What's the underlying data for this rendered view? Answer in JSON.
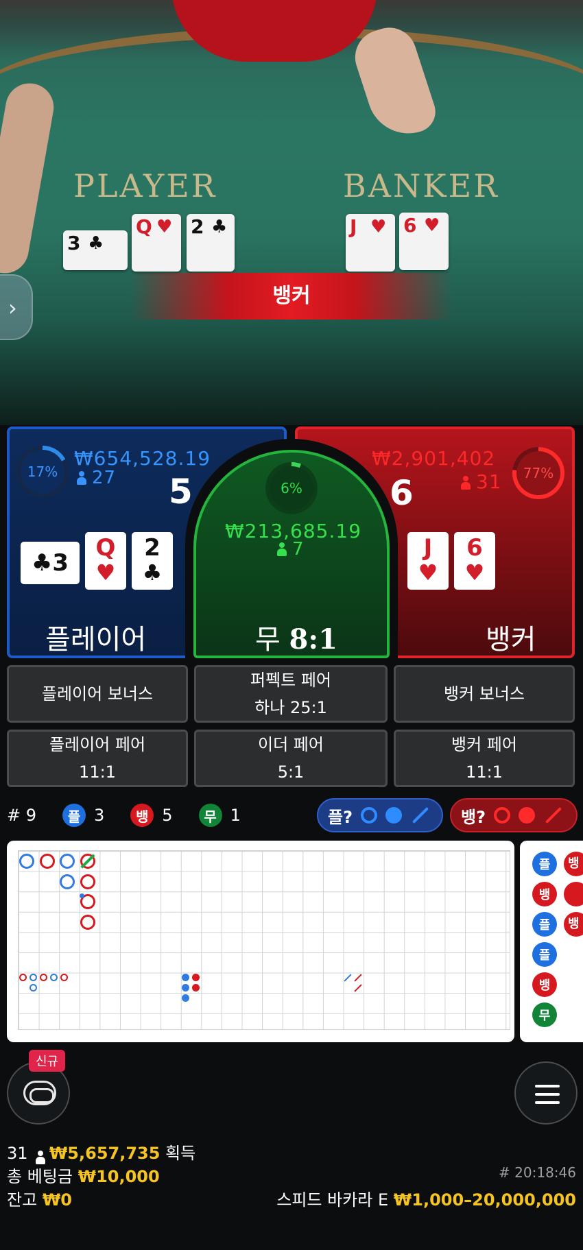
{
  "video": {
    "player_label": "PLAYER",
    "banker_label": "BANKER",
    "result": "뱅커",
    "side_toggle_icon": "chevron-right-icon",
    "player_cards": [
      {
        "rank": "3",
        "suit": "♣",
        "color": "black"
      },
      {
        "rank": "Q",
        "suit": "♥",
        "color": "red"
      },
      {
        "rank": "2",
        "suit": "♣",
        "color": "black"
      }
    ],
    "banker_cards": [
      {
        "rank": "J",
        "suit": "♥",
        "color": "red"
      },
      {
        "rank": "6",
        "suit": "♥",
        "color": "red"
      }
    ]
  },
  "player": {
    "percent": "17%",
    "amount": "₩654,528.19",
    "count": "27",
    "score": "5",
    "label": "플레이어",
    "cards": [
      {
        "rank": "3",
        "suit": "♣"
      },
      {
        "rank": "Q",
        "suit": "♥"
      },
      {
        "rank": "2",
        "suit": "♣"
      }
    ],
    "color": "#1f5bc7"
  },
  "tie": {
    "percent": "6%",
    "amount": "₩213,685.19",
    "count": "7",
    "label": "무",
    "payout": "8:1",
    "color": "#25b53e"
  },
  "banker": {
    "percent": "77%",
    "amount": "₩2,901,402",
    "count": "31",
    "score": "6",
    "label": "뱅커",
    "cards": [
      {
        "rank": "J",
        "suit": "♥"
      },
      {
        "rank": "6",
        "suit": "♥"
      }
    ],
    "color": "#e0242b"
  },
  "side_bets": {
    "player_bonus": "플레이어 보너스",
    "perfect_pair_line1": "퍼펙트 페어",
    "perfect_pair_line2": "하나 25:1",
    "banker_bonus": "뱅커 보너스",
    "player_pair_line1": "플레이어 페어",
    "player_pair_line2": "11:1",
    "either_pair_line1": "이더 페어",
    "either_pair_line2": "5:1",
    "banker_pair_line1": "뱅커 페어",
    "banker_pair_line2": "11:1"
  },
  "stats": {
    "round_label": "# 9",
    "player_short": "플",
    "player_wins": "3",
    "banker_short": "뱅",
    "banker_wins": "5",
    "tie_short": "무",
    "tie_wins": "1",
    "player_ask": "플?",
    "banker_ask": "뱅?"
  },
  "bead_road": [
    "플",
    "뱅",
    "플",
    "플",
    "뱅",
    "무"
  ],
  "bead_road_partial": [
    "뱅",
    "",
    "뱅"
  ],
  "bottom": {
    "new_badge": "신규",
    "chat_icon": "chat-icon",
    "menu_icon": "hamburger-menu-icon",
    "players_count": "31",
    "winnings": "₩5,657,735",
    "winnings_suffix": "획득",
    "total_bet_label": "총 베팅금",
    "total_bet": "₩10,000",
    "balance_label": "잔고",
    "balance": "₩0",
    "round_id": "# 20:18:46",
    "table_name": "스피드 바카라 E",
    "table_limits": "₩1,000–20,000,000"
  },
  "colors": {
    "player_blue": "#2f7be0",
    "banker_red": "#d6191f",
    "tie_green": "#118438",
    "highlight_yellow": "#f5c423"
  }
}
